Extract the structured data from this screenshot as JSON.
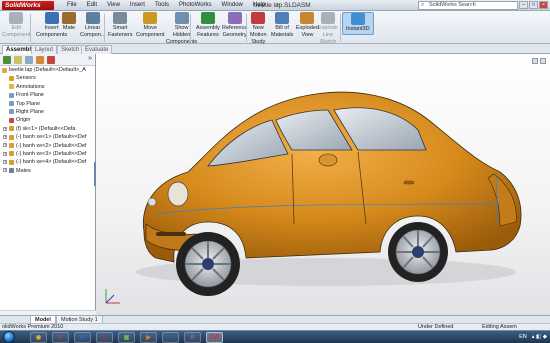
{
  "app": {
    "logo_text": "SolidWorks",
    "doc_title": "beetle lap.SLDASM",
    "search_placeholder": "SolidWorks Search"
  },
  "menu": [
    "File",
    "Edit",
    "View",
    "Insert",
    "Tools",
    "PhotoWorks",
    "Window",
    "Help"
  ],
  "menu_pin": "⇴",
  "toolbar": [
    {
      "id": "edit-component",
      "label1": "Edit",
      "label2": "Component",
      "dim": true,
      "color": "#a9b1ba"
    },
    {
      "id": "insert-components",
      "label1": "Insert",
      "label2": "Components",
      "dim": false,
      "color": "#3d6fb5"
    },
    {
      "id": "mate",
      "label1": "Mate",
      "label2": "",
      "dim": false,
      "color": "#9a6b2c"
    },
    {
      "id": "linear-component",
      "label1": "Linear",
      "label2": "Compon...",
      "dim": false,
      "color": "#5e7f9f"
    },
    {
      "id": "smart-fasteners",
      "label1": "Smart",
      "label2": "Fasteners",
      "dim": false,
      "color": "#7b8a99"
    },
    {
      "id": "move-component",
      "label1": "Move",
      "label2": "Component",
      "dim": false,
      "color": "#c99a1e"
    },
    {
      "id": "show-hidden",
      "label1": "Show",
      "label2": "Hidden",
      "label3": "Components",
      "dim": false,
      "color": "#6f8fae"
    },
    {
      "id": "assembly-features",
      "label1": "Assembly",
      "label2": "Features",
      "dim": false,
      "color": "#2e8f3c"
    },
    {
      "id": "reference-geometry",
      "label1": "Reference",
      "label2": "Geometry",
      "dim": false,
      "color": "#8a6fb8"
    },
    {
      "id": "new-motion-study",
      "label1": "New",
      "label2": "Motion",
      "label3": "Study",
      "dim": false,
      "color": "#c13c3c"
    },
    {
      "id": "bill-of-materials",
      "label1": "Bill of",
      "label2": "Materials",
      "dim": false,
      "color": "#4f7fb8"
    },
    {
      "id": "exploded-view",
      "label1": "Exploded",
      "label2": "View",
      "dim": false,
      "color": "#c7862f"
    },
    {
      "id": "explode-line-sketch",
      "label1": "Explode",
      "label2": "Line",
      "label3": "Sketch",
      "dim": true,
      "color": "#a9b1ba"
    },
    {
      "id": "instant3d",
      "label1": "Instant3D",
      "label2": "",
      "dim": false,
      "color": "#3f8fd3",
      "active": true
    }
  ],
  "tabs": [
    "Assembly",
    "Layout",
    "Sketch",
    "Evaluate"
  ],
  "tree": {
    "root": "beetle lap  (Default<<Default>_A",
    "items": [
      {
        "label": "Sensors",
        "color": "#d9a21a"
      },
      {
        "label": "Annotations",
        "color": "#e0b93c"
      },
      {
        "label": "Front Plane",
        "color": "#7a9cc6"
      },
      {
        "label": "Top Plane",
        "color": "#7a9cc6"
      },
      {
        "label": "Right Plane",
        "color": "#7a9cc6"
      },
      {
        "label": "Origin",
        "color": "#c44"
      },
      {
        "label": "(f) sk<1> (Default<<Defa",
        "color": "#d6a02a"
      },
      {
        "label": "(-) banh xe<1> (Default<<Def",
        "color": "#d6a02a"
      },
      {
        "label": "(-) banh xe<2> (Default<<Def",
        "color": "#d6a02a"
      },
      {
        "label": "(-) banh xe<3> (Default<<Def",
        "color": "#d6a02a"
      },
      {
        "label": "(-) banh xe<4> (Default<<Def",
        "color": "#d6a02a"
      },
      {
        "label": "Mates",
        "color": "#6b7e93"
      }
    ]
  },
  "model_tabs": [
    "Model",
    "Motion Study 1"
  ],
  "status": {
    "product": "olidWorks Premium 2010",
    "state": "Under Defined",
    "mode": "Editing Assem"
  },
  "taskbar": {
    "apps": [
      {
        "icon": "chrome-app-icon",
        "glyph": "◉",
        "color": "#e8b12a"
      },
      {
        "icon": "unikey-app-icon",
        "glyph": "V",
        "color": "#d04040"
      },
      {
        "icon": "word-app-icon",
        "glyph": "W",
        "color": "#2f6cc7"
      },
      {
        "icon": "solidworks-app-icon",
        "glyph": "S",
        "color": "#c9302c"
      },
      {
        "icon": "paint-app-icon",
        "glyph": "▣",
        "color": "#7ab648"
      },
      {
        "icon": "player-app-icon",
        "glyph": "▶",
        "color": "#e07b1f"
      },
      {
        "icon": "photoshop-app-icon",
        "glyph": "Ps",
        "color": "#2c5ea8"
      },
      {
        "icon": "winrar-app-icon",
        "glyph": "R",
        "color": "#8e5fb0"
      },
      {
        "icon": "sw-window-icon",
        "glyph": "SW",
        "color": "#c9302c"
      }
    ],
    "lang": "EN"
  }
}
